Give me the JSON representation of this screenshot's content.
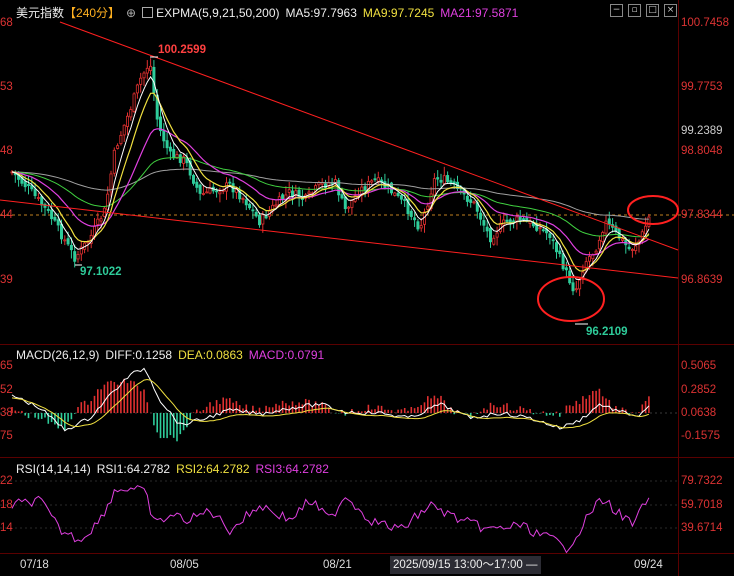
{
  "main": {
    "title": "美元指数",
    "period": "【240分】",
    "expma_label": "EXPMA(5,9,21,50,200)",
    "ma5": "MA5:97.7963",
    "ma9": "MA9:97.7245",
    "ma21": "MA21:97.5871",
    "right_axis": [
      "100.7458",
      "99.7753",
      "99.2389",
      "98.8048",
      "97.8344",
      "96.8639"
    ],
    "left_axis": [
      "68",
      "53",
      "48",
      "44",
      "39"
    ],
    "high_label": "100.2599",
    "low_label": "97.1022",
    "recent_low_label": "96.2109"
  },
  "macd": {
    "label": "MACD(26,12,9)",
    "diff": "DIFF:0.1258",
    "dea": "DEA:0.0863",
    "macd": "MACD:0.0791",
    "right_axis": [
      "0.5065",
      "0.2852",
      "0.0638",
      "-0.1575"
    ],
    "left_axis": [
      "65",
      "52",
      "38",
      "75"
    ]
  },
  "rsi": {
    "label": "RSI(14,14,14)",
    "rsi1": "RSI1:64.2782",
    "rsi2": "RSI2:64.2782",
    "rsi3": "RSI3:64.2782",
    "right_axis": [
      "79.7322",
      "59.7018",
      "39.6714"
    ],
    "left_axis": [
      "22",
      "18",
      "14"
    ]
  },
  "xaxis": {
    "dates": [
      "07/18",
      "08/05",
      "08/21",
      "09/24"
    ],
    "cursor_tip": "2025/09/15 13:00～17:00 —"
  },
  "controls": [
    "minimize-icon",
    "restore-icon",
    "maximize-icon",
    "close-icon"
  ],
  "colors": {
    "up": "#e03030",
    "down": "#2ecc9a",
    "ma5": "#ffffff",
    "ma9": "#f0e040",
    "ma21": "#e040e0",
    "ma50": "#40d040",
    "ma200": "#a0a0a0",
    "annot": "#ff2020",
    "low_text": "#2ecc9a",
    "high_text": "#ff4040"
  },
  "chart_data": {
    "type": "line",
    "series": [
      {
        "name": "MA5",
        "values": [
          98.0,
          97.5,
          97.2,
          97.4,
          98.5,
          100.0,
          99.0,
          98.4,
          98.2,
          98.0,
          97.9,
          98.0,
          98.1,
          98.0,
          97.9,
          97.8,
          97.7,
          97.6,
          97.5,
          97.0,
          96.7,
          97.4,
          97.8,
          97.5,
          97.8
        ]
      },
      {
        "name": "RSI1",
        "values": [
          62,
          48,
          40,
          45,
          70,
          74,
          50,
          55,
          52,
          50,
          55,
          52,
          54,
          50,
          48,
          50,
          47,
          45,
          40,
          34,
          30,
          45,
          60,
          50,
          64
        ]
      }
    ],
    "y_range_main": [
      96.2109,
      100.2599
    ]
  }
}
